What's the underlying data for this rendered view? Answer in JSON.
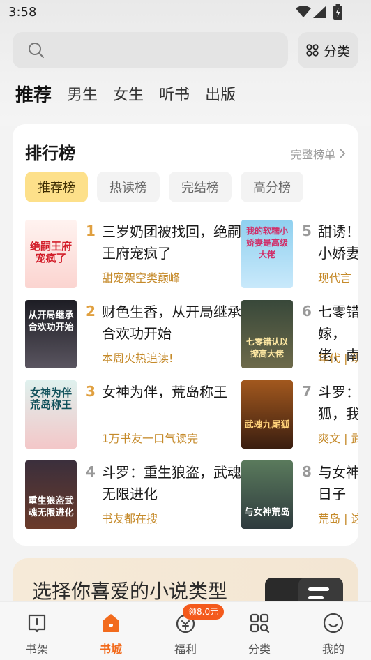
{
  "status_bar": {
    "time": "3:58"
  },
  "header": {
    "search_placeholder": "",
    "category_button": "分类",
    "tabs": [
      "推荐",
      "男生",
      "女生",
      "听书",
      "出版"
    ]
  },
  "ranking": {
    "title": "排行榜",
    "more_label": "完整榜单",
    "chips": [
      "推荐榜",
      "热读榜",
      "完结榜",
      "高分榜"
    ],
    "books": [
      {
        "rank": "1",
        "title": "三岁奶团被找回，绝嗣王府宠疯了",
        "tag": "甜宠架空类巅峰",
        "cover_text": "绝嗣王府宠疯了"
      },
      {
        "rank": "2",
        "title": "财色生香，从开局继承合欢功开始",
        "tag": "本周火热追读!",
        "cover_text": "从开局继承合欢功开始"
      },
      {
        "rank": "3",
        "title": "女神为伴，荒岛称王",
        "tag": "1万书友一口气读完",
        "cover_text": "女神为伴荒岛称王"
      },
      {
        "rank": "4",
        "title": "斗罗：重生狼盗，武魂无限进化",
        "tag": "书友都在搜",
        "cover_text": "重生狼盗武魂无限进化"
      },
      {
        "rank": "5",
        "title": "甜诱！小娇妻",
        "tag": "现代言",
        "cover_text": "我的软糯小娇妻是高级大佬"
      },
      {
        "rank": "6",
        "title": "七零错嫁，佬，南",
        "tag": "年代 | 现",
        "cover_text": "七零错认以撩高大佬"
      },
      {
        "rank": "7",
        "title": "斗罗：狐，我",
        "tag": "爽文 | 武",
        "cover_text": "武魂九尾狐"
      },
      {
        "rank": "8",
        "title": "与女神日子",
        "tag": "荒岛 | 这",
        "cover_text": "与女神荒岛"
      }
    ]
  },
  "genre_banner": {
    "text": "选择你喜爱的小说类型"
  },
  "bottom_nav": {
    "items": [
      "书架",
      "书城",
      "福利",
      "分类",
      "我的"
    ],
    "welfare_badge": "领8.0元"
  },
  "colors": {
    "accent": "#f26b1d",
    "chip_active": "#fde08a",
    "tag": "#c58a2a"
  }
}
